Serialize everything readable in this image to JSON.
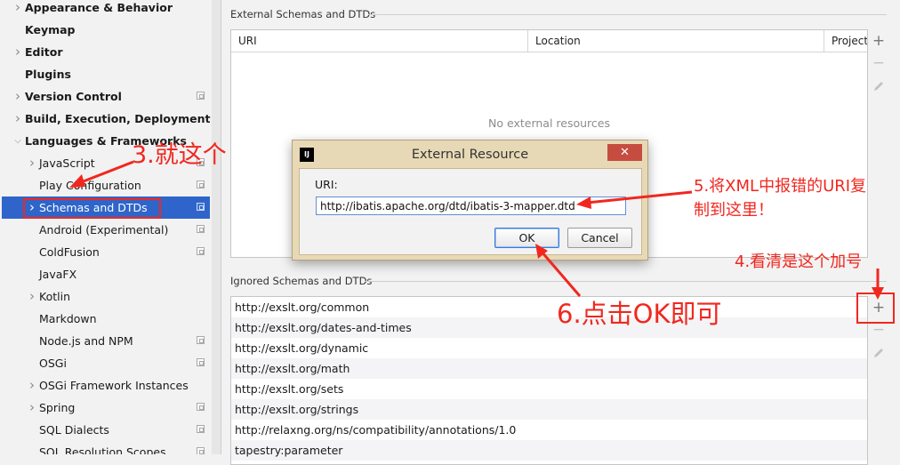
{
  "sidebar": {
    "items": [
      {
        "label": "Appearance & Behavior",
        "bold": true,
        "arrow": "right",
        "config": false
      },
      {
        "label": "Keymap",
        "bold": true,
        "arrow": "",
        "config": false
      },
      {
        "label": "Editor",
        "bold": true,
        "arrow": "right",
        "config": false
      },
      {
        "label": "Plugins",
        "bold": true,
        "arrow": "",
        "config": false
      },
      {
        "label": "Version Control",
        "bold": true,
        "arrow": "right",
        "config": true
      },
      {
        "label": "Build, Execution, Deployment",
        "bold": true,
        "arrow": "right",
        "config": false
      },
      {
        "label": "Languages & Frameworks",
        "bold": true,
        "arrow": "down",
        "config": false
      },
      {
        "label": "JavaScript",
        "bold": false,
        "arrow": "right",
        "config": true
      },
      {
        "label": "Play Configuration",
        "bold": false,
        "arrow": "",
        "config": true
      },
      {
        "label": "Schemas and DTDs",
        "bold": false,
        "arrow": "right",
        "config": true,
        "selected": true
      },
      {
        "label": "Android (Experimental)",
        "bold": false,
        "arrow": "",
        "config": true
      },
      {
        "label": "ColdFusion",
        "bold": false,
        "arrow": "",
        "config": true
      },
      {
        "label": "JavaFX",
        "bold": false,
        "arrow": "",
        "config": false
      },
      {
        "label": "Kotlin",
        "bold": false,
        "arrow": "right",
        "config": false
      },
      {
        "label": "Markdown",
        "bold": false,
        "arrow": "",
        "config": false
      },
      {
        "label": "Node.js and NPM",
        "bold": false,
        "arrow": "",
        "config": true
      },
      {
        "label": "OSGi",
        "bold": false,
        "arrow": "",
        "config": true
      },
      {
        "label": "OSGi Framework Instances",
        "bold": false,
        "arrow": "right",
        "config": false
      },
      {
        "label": "Spring",
        "bold": false,
        "arrow": "right",
        "config": true
      },
      {
        "label": "SQL Dialects",
        "bold": false,
        "arrow": "",
        "config": true
      },
      {
        "label": "SQL Resolution Scopes",
        "bold": false,
        "arrow": "",
        "config": true
      }
    ]
  },
  "external": {
    "title": "External Schemas and DTDs",
    "columns": [
      "URI",
      "Location",
      "Project"
    ],
    "empty_text": "No external resources"
  },
  "ignored": {
    "title": "Ignored Schemas and DTDs",
    "rows": [
      "http://exslt.org/common",
      "http://exslt.org/dates-and-times",
      "http://exslt.org/dynamic",
      "http://exslt.org/math",
      "http://exslt.org/sets",
      "http://exslt.org/strings",
      "http://relaxng.org/ns/compatibility/annotations/1.0",
      "tapestry:parameter"
    ]
  },
  "tools": {
    "add": "+",
    "remove": "−"
  },
  "dialog": {
    "app_icon": "IJ",
    "title": "External Resource",
    "close": "✕",
    "uri_label": "URI:",
    "uri_value": "http://ibatis.apache.org/dtd/ibatis-3-mapper.dtd",
    "ok": "OK",
    "cancel": "Cancel"
  },
  "annotations": {
    "a3": "3.就这个",
    "a4": "4.看清是这个加号",
    "a5_line1": "5.将XML中报错的URI复",
    "a5_line2": "制到这里！",
    "a6": "6.点击OK即可",
    "color": "#f1271f"
  },
  "colors": {
    "selection": "#2f65ca",
    "accent_red": "#f1271f"
  }
}
